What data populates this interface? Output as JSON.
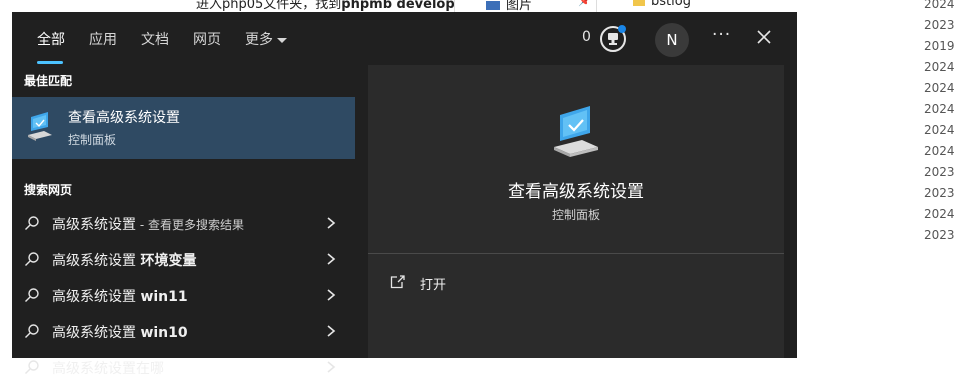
{
  "background": {
    "path_text_prefix": "进入php05文件夹，找到",
    "path_text_bold": "phpmb develop",
    "pictures_label": "图片",
    "folder_label": "bstlog",
    "dates": [
      "2024,",
      "2023,",
      "2019,",
      "2024,",
      "2024,",
      "2024,",
      "2024,",
      "2024,",
      "2023,",
      "2023,",
      "2024,",
      "2023,"
    ]
  },
  "tabs": [
    "全部",
    "应用",
    "文档",
    "网页",
    "更多"
  ],
  "header": {
    "points": "0",
    "avatar_initial": "N",
    "more_label": "···"
  },
  "left": {
    "best_match_heading": "最佳匹配",
    "best_match": {
      "title": "查看高级系统设置",
      "subtitle": "控制面板"
    },
    "web_heading": "搜索网页",
    "results": [
      {
        "text": "高级系统设置",
        "hint": " - 查看更多搜索结果",
        "bold_suffix": ""
      },
      {
        "text": "高级系统设置 ",
        "hint": "",
        "bold_suffix": "环境变量"
      },
      {
        "text": "高级系统设置 ",
        "hint": "",
        "bold_suffix": "win11"
      },
      {
        "text": "高级系统设置 ",
        "hint": "",
        "bold_suffix": "win10"
      },
      {
        "text": "高级系统设置在哪",
        "hint": "",
        "bold_suffix": ""
      }
    ]
  },
  "right": {
    "title": "查看高级系统设置",
    "subtitle": "控制面板",
    "open_label": "打开"
  },
  "colors": {
    "accent": "#4cc2ff",
    "selected_row": "#2f4a63",
    "panel": "#202020",
    "preview": "#2b2b2b"
  }
}
